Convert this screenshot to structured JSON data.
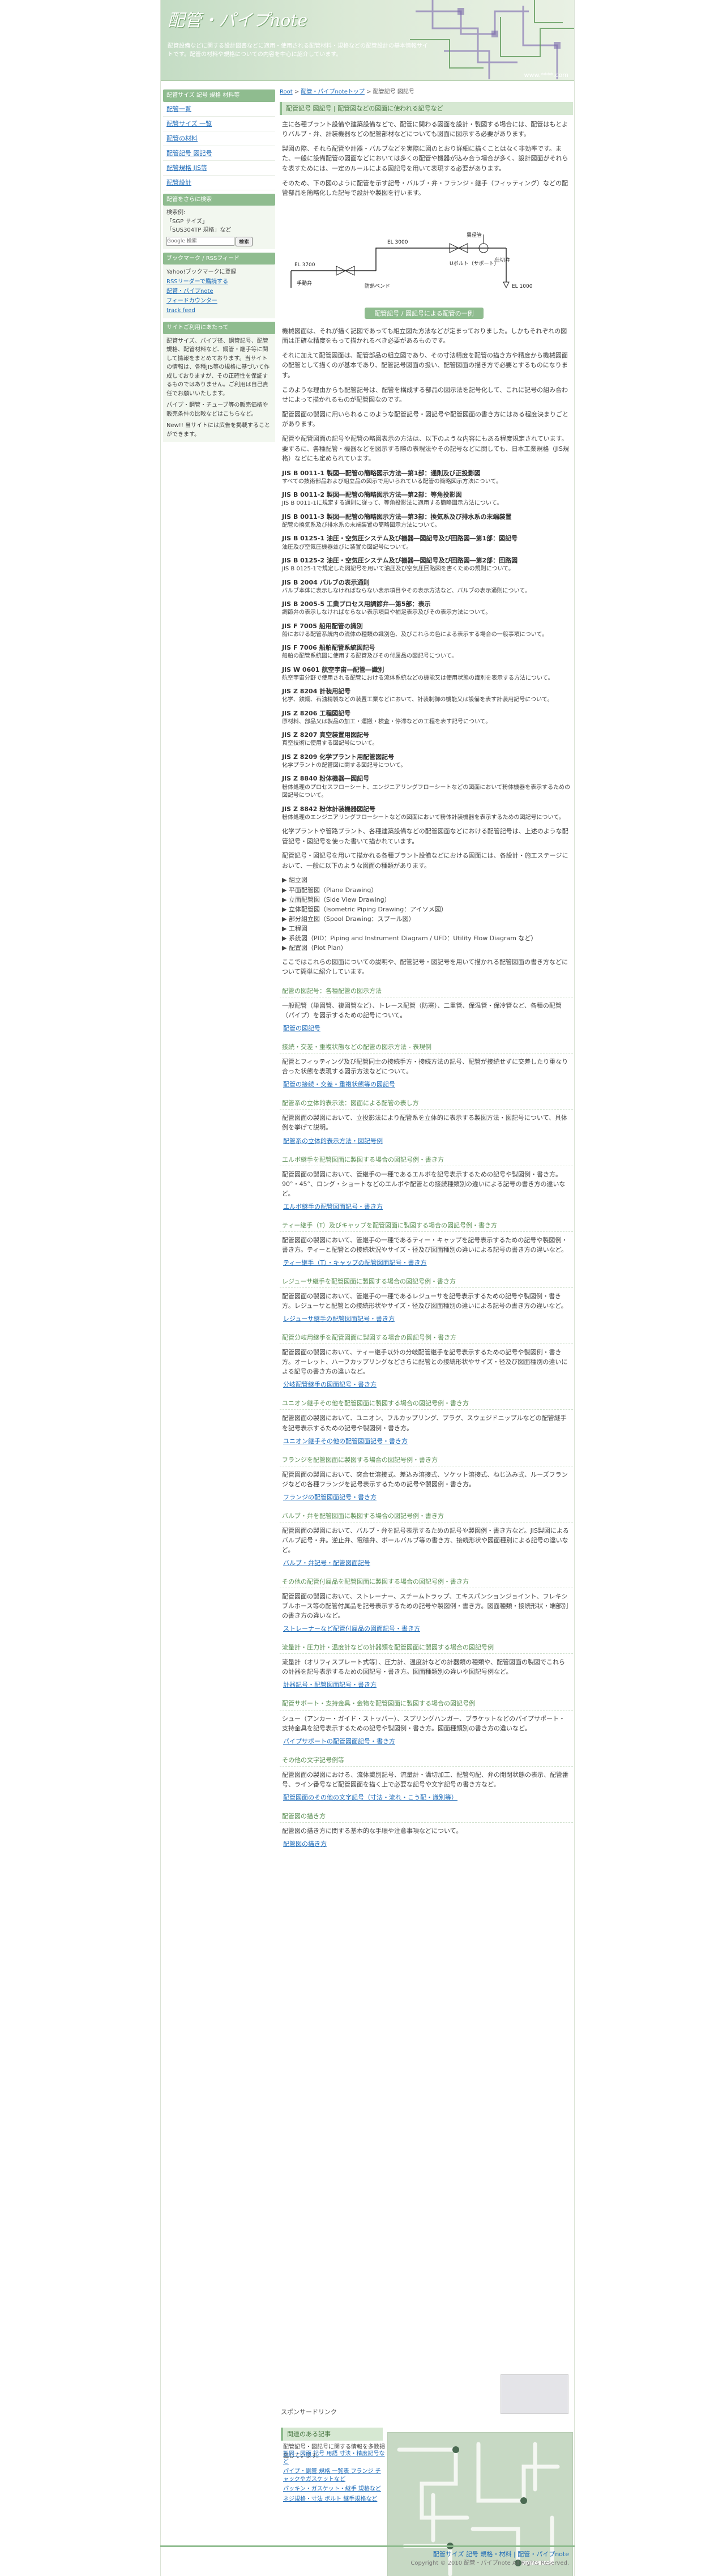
{
  "header": {
    "logo": "配管・パイプnote",
    "tagline": "配管設備などに関する設計図書などに適用・使用される配管材料・規格などの配管設計の基本情報サイトです。配管の材料や規格についての内容を中心に紹介しています。",
    "url": "www.****.com"
  },
  "sidebar": {
    "categories_heading": "配管サイズ 記号 規格 材料等",
    "items": [
      "配管一覧",
      "配管サイズ 一覧",
      "配管の材料",
      "配管記号 図記号",
      "配管規格 JIS等",
      "配管設計"
    ],
    "search_heading": "配管をさらに検索",
    "search_label": "検索例:",
    "search_ex1": "「SGP サイズ」",
    "search_ex2": "「SUS304TP 規格」など",
    "search_placeholder": "Google 検索",
    "search_button": "検索",
    "bookmark_heading": "ブックマーク / RSSフィード",
    "bookmark_yahoo": "Yahoo!ブックマークに登録",
    "bookmark_rss": "RSSリーダーで購読する",
    "bookmark_feed": "配管・パイプnote",
    "bookmark_feedburner": "フィードカウンター",
    "bookmark_track": "track feed",
    "about_heading": "サイトご利用にあたって",
    "about_text1": "配管サイズ、パイプ径、鋼管記号、配管規格、配管材料など、鋼管・継手等に関して情報をまとめております。当サイトの情報は、各種JIS等の規格に基づいて作成しておりますが、その正確性を保証するものではありません。ご利用は自己責任でお願いいたします。",
    "about_text2": "パイプ・鋼管・チューブ等の販売価格や販売条件の比較などはこちらなど。",
    "about_text3": "New!! 当サイトには広告を掲載することができます。"
  },
  "breadcrumb": {
    "root": "Root",
    "site": "配管・パイプnoteトップ",
    "current": "配管記号 図記号"
  },
  "main": {
    "title": "配管記号 図記号 | 配管図などの図面に使われる記号など",
    "p1": "主に各種プラント設備や建築設備などで、配管に関わる図面を設計・製図する場合には、配管はもとよりバルブ・弁、計装機器などの配管部材などについても図面に図示する必要があります。",
    "p2": "製図の際、それら配管や計器・バルブなどを実際に図のとおり詳細に描くことはなく非効率です。また、一般に設備配管の図面などにおいては多くの配管や機器が込み合う場合が多く、設計図面がそれらを表すためには、一定のルールによる図記号を用いて表現する必要があります。",
    "p3": "そのため、下の図のように配管を示す記号・バルブ・弁・フランジ・継手（フィッティング）などの配管部品を簡略化した記号で設計や製図を行います。",
    "p4": "機械図面は、それが描く記図であっても組立図た方法などが定まっておりました。しかもそれぞれの図面は正確な精度をもって描かれるべき必要があるものです。",
    "p5": "それに加えて配管図面は、配管部品の組立図であり、その寸法精度を配管の描き方や精度から機械図面の配管として描くのが基本であり、配管記号図面の扱い、配管図面の描き方で必要とするものになります。",
    "p6": "このような理由からも配管記号は、配管を構成する部品の図示法を記号化して、これに記号の組み合わせによって描かれるものが配管図なのです。",
    "p7": "配管図面の製図に用いられるこのような配管記号・図記号や配管図面の書き方にはある程度決まりごとがあります。",
    "p8": "配管や配管図面の記号や配管の略図表示の方法は、以下のような内容にもある程度規定されています。要するに、各種配管・機器などを図示する際の表現法やその記号などに関しても、日本工業規格（JIS規格）などにも定められています。",
    "p9": "化学プラントや管路プラント、各種建築設備などの配管図面などにおける配管記号は、上述のような配管記号・図記号を使った書いて描かれています。",
    "p10": "配管記号・図記号を用いて描かれる各種プラント設備などにおける図面には、各設計・施工ステージにおいて、一般に以下のような図面の種類があります。",
    "p11": "ここではこれらの図面についての説明や、配管記号・図記号を用いて描かれる配管図面の書き方などについて簡単に紹介しています。"
  },
  "diagram": {
    "el1": "EL 3700",
    "el2": "EL 3000",
    "el3": "異径管",
    "stud": "手動弁",
    "boss": "防熱ベンド",
    "uval": "Uボルト（サポート）",
    "gate": "仕切弁",
    "el4": "EL 1000",
    "caption": "配管記号 / 図記号による配管の一例"
  },
  "specs": [
    {
      "title": "JIS B 0011-1 製図―配管の簡略図示方法―第1部：通則及び正投影図",
      "desc": "すべての技術部品および組立品の図示で用いられている配管の簡略図示方法について。"
    },
    {
      "title": "JIS B 0011-2 製図―配管の簡略図示方法―第2部：等角投影図",
      "desc": "JIS B 0011-1に規定する通則に従って、等角投影法に適用する簡略図示方法について。"
    },
    {
      "title": "JIS B 0011-3 製図―配管の簡略図示方法―第3部：換気系及び排水系の末端装置",
      "desc": "配管の換気系及び排水系の末端装置の簡略図示方法について。"
    },
    {
      "title": "JIS B 0125-1 油圧・空気圧システム及び機器―図記号及び回路図―第1部：図記号",
      "desc": "油圧及び空気圧機器並びに装置の図記号について。"
    },
    {
      "title": "JIS B 0125-2 油圧・空気圧システム及び機器―図記号及び回路図―第2部：回路図",
      "desc": "JIS B 0125-1で規定した図記号を用いて油圧及び空気圧回路図を書くための規則について。"
    },
    {
      "title": "JIS B 2004 バルブの表示通則",
      "desc": "バルブ本体に表示しなければならない表示項目やその表示方法など、バルブの表示通則について。"
    },
    {
      "title": "JIS B 2005-5 工業プロセス用調節弁―第5部：表示",
      "desc": "調節弁の表示しなければならない表示項目や補足表示及びその表示方法について。"
    },
    {
      "title": "JIS F 7005 船用配管の識別",
      "desc": "船における配管系統内の流体の種類の識別色、及びこれらの色による表示する場合の一般事項について。"
    },
    {
      "title": "JIS F 7006 船舶配管系統図記号",
      "desc": "船舶の配管系統図に使用する配管及びその付属品の図記号について。"
    },
    {
      "title": "JIS W 0601 航空宇宙―配管―識別",
      "desc": "航空宇宙分野で使用される配管における流体系統などの機能又は使用状態の識別を表示する方法について。"
    },
    {
      "title": "JIS Z 8204 計装用記号",
      "desc": "化学、鉄鋼、石油精製などの装置工業などにおいて、計装制御の機能又は設備を表す計装用記号について。"
    },
    {
      "title": "JIS Z 8206 工程図記号",
      "desc": "原材料、部品又は製品の加工・運搬・検査・停滞などの工程を表す記号について。"
    },
    {
      "title": "JIS Z 8207 真空装置用図記号",
      "desc": "真空技術に使用する図記号について。"
    },
    {
      "title": "JIS Z 8209 化学プラント用配管図記号",
      "desc": "化学プラントの配管図に関する図記号について。"
    },
    {
      "title": "JIS Z 8840 粉体機器―図記号",
      "desc": "粉体処理のプロセスフローシート、エンジニアリングフローシートなどの図面において粉体機器を表示するための図記号について。"
    },
    {
      "title": "JIS Z 8842 粉体計装機器図記号",
      "desc": "粉体処理のエンジニアリングフローシートなどの図面において粉体計装機器を表示するための図記号について。"
    }
  ],
  "drawing_types": [
    "▶ 組立図",
    "▶ 平面配管図（Plane Drawing）",
    "▶ 立面配管図（Side View Drawing）",
    "▶ 立体配管図（Isometric Piping Drawing：アイソメ図）",
    "▶ 部分組立図（Spool Drawing：スプール図）",
    "▶ 工程図",
    "▶ 系統図（PID：Piping and Instrument Diagram / UFD：Utility Flow Diagram など）",
    "▶ 配置図（Plot Plan）"
  ],
  "sections": [
    {
      "heading": "配管の図記号：各種配管の図示方法",
      "text": "一般配管（単図管、複図管など）、トレース配管（防寒）、二重管、保温管・保冷管など、各種の配管（パイプ）を図示するための記号について。",
      "link": "配管の図記号"
    },
    {
      "heading": "接続・交差・重複状態などの配管の図示方法 - 表現例",
      "text": "配管とフィッティング及び配管同士の接続手方・接続方法の記号、配管が接続せずに交差したり重なり合った状態を表現する図示方法などについて。",
      "link": "配管の接続・交差・重複状態等の図記号"
    },
    {
      "heading": "配管系の立体的表示法：図面による配管の表し方",
      "text": "配管図面の製図において、立投影法により配管系を立体的に表示する製図方法・図記号について、具体例を挙げて説明。",
      "link": "配管系の立体的表示方法・図記号例"
    },
    {
      "heading": "エルボ継手を配管図面に製図する場合の図記号例・書き方",
      "text": "配管図面の製図において、管継手の一種であるエルボを記号表示するための記号や製図例・書き方。90°・45°、ロング・ショートなどのエルボや配管との接続種類別の違いによる記号の書き方の違いなど。",
      "link": "エルボ継手の配管図面記号・書き方"
    },
    {
      "heading": "ティー継手（T）及びキャップを配管図面に製図する場合の図記号例・書き方",
      "text": "配管図面の製図において、管継手の一種であるティー・キャップを記号表示するための記号や製図例・書き方。ティーと配管との接続状況やサイズ・径及び図面種別の違いによる記号の書き方の違いなど。",
      "link": "ティー継手（T）・キャップの配管図面記号・書き方"
    },
    {
      "heading": "レジューサ継手を配管図面に製図する場合の図記号例・書き方",
      "text": "配管図面の製図において、管継手の一種であるレジューサを記号表示するための記号や製図例・書き方。レジューサと配管との接続形状やサイズ・径及び図面種別の違いによる記号の書き方の違いなど。",
      "link": "レジューサ継手の配管図面記号・書き方"
    },
    {
      "heading": "配管分岐用継手を配管図面に製図する場合の図記号例・書き方",
      "text": "配管図面の製図において、ティー継手以外の分岐配管継手を記号表示するための記号や製図例・書き方。オーレット、ハーフカップリングなどさらに配管との接続形状やサイズ・径及び図面種別の違いによる記号の書き方の違いなど。",
      "link": "分岐配管継手の図面記号・書き方"
    },
    {
      "heading": "ユニオン継手その他を配管図面に製図する場合の図記号例・書き方",
      "text": "配管図面の製図において、ユニオン、フルカップリング、プラグ、スウェジドニップルなどの配管継手を記号表示するための記号や製図例・書き方。",
      "link": "ユニオン継手その他の配管図面記号・書き方"
    },
    {
      "heading": "フランジを配管図面に製図する場合の図記号例・書き方",
      "text": "配管図面の製図において、突合せ溶接式、差込み溶接式、ソケット溶接式、ねじ込み式、ルーズフランジなどの各種フランジを記号表示するための記号や製図例・書き方。",
      "link": "フランジの配管図面記号・書き方"
    },
    {
      "heading": "バルブ・弁を配管図面に製図する場合の図記号例・書き方",
      "text": "配管図面の製図において、バルブ・弁を記号表示するための記号や製図例・書き方など。JIS製図によるバルブ記号・弁。逆止弁、電磁弁、ボールバルブ等の書き方、接続形状や図面種別による記号の違いなど。",
      "link": "バルブ・弁記号・配管図面記号"
    },
    {
      "heading": "その他の配管付属品を配管図面に製図する場合の図記号例・書き方",
      "text": "配管図面の製図において、ストレーナー、スチームトラップ、エキスパンションジョイント、フレキシブルホース等の配管付属品を記号表示するための記号や製図例・書き方。図面種類・接続形状・端部別の書き方の違いなど。",
      "link": "ストレーナーなど配管付属品の図面記号・書き方"
    },
    {
      "heading": "流量計・圧力計・温度計などの計器類を配管図面に製図する場合の図記号例",
      "text": "流量計（オリフィスプレート式等）、圧力計、温度計などの計器類の種類や、配管図面の製図でこれらの計器を記号表示するための図記号・書き方。図面種類別の違いや図記号例など。",
      "link": "計器記号・配管図面記号・書き方"
    },
    {
      "heading": "配管サポート・支持金具・金物を配管図面に製図する場合の図記号例",
      "text": "シュー（アンカー・ガイド・ストッパー）、スプリングハンガー、ブラケットなどのパイプサポート・支持金具を記号表示するための記号や製図例・書き方。図面種類別の書き方の違いなど。",
      "link": "パイプサポートの配管図面記号・書き方"
    },
    {
      "heading": "その他の文字記号例等",
      "text": "配管図面の製図における、流体識別記号、流量計・溝切加工、配管勾配、弁の開閉状態の表示、配管番号、ライン番号など配管図面を描く上で必要な記号や文字記号の書き方など。",
      "link": "配管図面のその他の文字記号（寸法・流れ・こう配・識別等）"
    },
    {
      "heading": "配管図の描き方",
      "text": "配管図の描き方に関する基本的な手順や注意事項などについて。",
      "link": "配管図の描き方"
    }
  ],
  "related": {
    "heading": "関連のある記事",
    "intro": "配管記号・図記号に関する情報を多数掲載しています。",
    "items": [
      "製図・図面 記号 用語 寸法・精度記号など",
      "パイプ・鋼管 規格 一覧表 フランジ チャックやガスケットなど",
      "パッキン・ガスケット・継手 規格など",
      "ネジ規格・寸法 ボルト 継手規格など"
    ]
  },
  "footer_area": {
    "sponsor": "スポンサードリンク",
    "links": "配管サイズ 記号 規格・材料 | 配管・パイプnote",
    "copyright": "Copyright © 2010 配管・パイプnote All Rights Reserved."
  },
  "colors": {
    "accent": "#8fbc8f",
    "link": "#1e6bb8",
    "header_bg": "#c4dcc4",
    "section_heading": "#5b8f55"
  }
}
